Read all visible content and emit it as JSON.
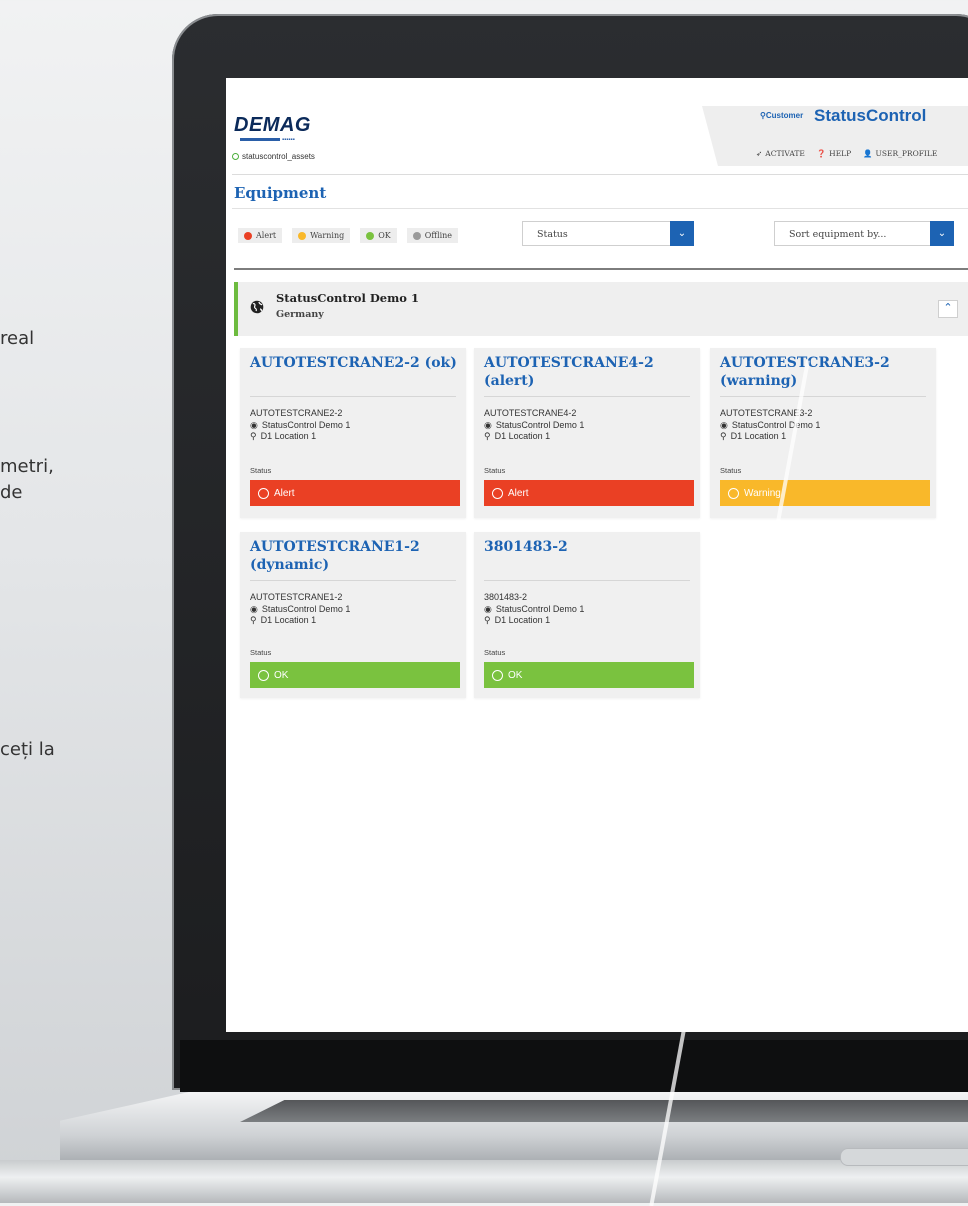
{
  "side_text": [
    "real",
    "metri,",
    "de",
    "ceți la"
  ],
  "colors": {
    "brand_blue": "#1d63b3",
    "alert": "#ea4024",
    "warning": "#f9b82a",
    "ok": "#7ac23f",
    "offline": "#9a9a9a"
  },
  "header": {
    "logo": "DEMAG",
    "asset_tag": "statuscontrol_assets",
    "customer_label": "Customer",
    "brand": "StatusControl",
    "nav": {
      "activate": "ACTIVATE",
      "help": "HELP",
      "user_profile": "USER_PROFILE"
    }
  },
  "page_title": "Equipment",
  "legend": {
    "alert": "Alert",
    "warning": "Warning",
    "ok": "OK",
    "offline": "Offline"
  },
  "filters": {
    "status_value": "Status",
    "sort_value": "Sort equipment by..."
  },
  "group": {
    "name": "StatusControl Demo 1",
    "country": "Germany"
  },
  "cards": [
    {
      "title": "AUTOTESTCRANE2-2 (ok)",
      "asset": "AUTOTESTCRANE2-2",
      "site": "StatusControl Demo 1",
      "location": "D1 Location 1",
      "status_label": "Status",
      "status": "Alert",
      "status_color": "#ea4024"
    },
    {
      "title": "AUTOTESTCRANE4-2 (alert)",
      "asset": "AUTOTESTCRANE4-2",
      "site": "StatusControl Demo 1",
      "location": "D1 Location 1",
      "status_label": "Status",
      "status": "Alert",
      "status_color": "#ea4024"
    },
    {
      "title": "AUTOTESTCRANE3-2 (warning)",
      "asset": "AUTOTESTCRANE3-2",
      "site": "StatusControl Demo 1",
      "location": "D1 Location 1",
      "status_label": "Status",
      "status": "Warning",
      "status_color": "#f9b82a"
    },
    {
      "title": "AUTOTESTCRANE1-2 (dynamic)",
      "asset": "AUTOTESTCRANE1-2",
      "site": "StatusControl Demo 1",
      "location": "D1 Location 1",
      "status_label": "Status",
      "status": "OK",
      "status_color": "#7ac23f"
    },
    {
      "title": "3801483-2",
      "asset": "3801483-2",
      "site": "StatusControl Demo 1",
      "location": "D1 Location 1",
      "status_label": "Status",
      "status": "OK",
      "status_color": "#7ac23f"
    }
  ]
}
